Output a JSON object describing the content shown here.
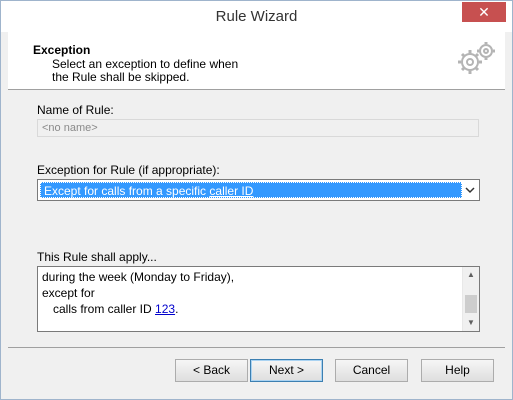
{
  "window": {
    "title": "Rule Wizard",
    "close_glyph": "✕"
  },
  "header": {
    "title": "Exception",
    "description": "Select an exception to define when\nthe Rule shall be skipped.",
    "icon": "gears-icon"
  },
  "form": {
    "name_label": "Name of Rule:",
    "name_placeholder": "<no name>",
    "exception_label": "Exception for Rule (if appropriate):",
    "exception_selected_prefix": "Except for calls from a specific ",
    "exception_selected_link": "caller ID",
    "apply_label": "This Rule shall apply...",
    "summary_line1": "during the week (Monday to Friday),",
    "summary_line2": "except for",
    "summary_line3_prefix": "calls from caller ID ",
    "summary_line3_link": "123",
    "summary_line3_suffix": "."
  },
  "buttons": {
    "back": "< Back",
    "next": "Next >",
    "cancel": "Cancel",
    "help": "Help"
  },
  "colors": {
    "selection": "#3399ff",
    "link": "#0000cc",
    "close": "#c75050"
  }
}
